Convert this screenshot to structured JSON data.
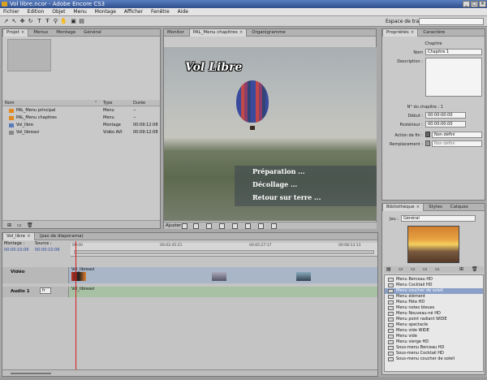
{
  "window": {
    "title": "Vol libre.ncor - Adobe Encore CS3"
  },
  "menubar": [
    "Fichier",
    "Edition",
    "Objet",
    "Menu",
    "Montage",
    "Afficher",
    "Fenêtre",
    "Aide"
  ],
  "toolbar": {
    "workspace_label": "Espace de travail :",
    "workspace_value": ""
  },
  "project": {
    "tabs": [
      "Projet",
      "Menus",
      "Montage",
      "Général"
    ],
    "columns": {
      "name": "Nom",
      "type": "Type",
      "duration": "Durée"
    },
    "rows": [
      {
        "name": "PAL_Menu principal",
        "type": "Menu",
        "duration": "--",
        "icon": "menu-icon",
        "color": "#e08a20"
      },
      {
        "name": "PAL_Menu chapitres",
        "type": "Menu",
        "duration": "--",
        "icon": "menu-icon",
        "color": "#e08a20"
      },
      {
        "name": "Vol_libre",
        "type": "Montage",
        "duration": "00:09:12:08",
        "icon": "timeline-icon",
        "color": "#5a7ab8"
      },
      {
        "name": "Vol_libreavi",
        "type": "Vidéo AVI",
        "duration": "00:09:12:08",
        "icon": "film-icon",
        "color": "#888888"
      }
    ]
  },
  "monitor": {
    "tabs": [
      "Monitor",
      "PAL_Menu chapitres",
      "Organigramme"
    ],
    "active_tab": "PAL_Menu chapitres",
    "menu_title": "Vol Libre",
    "menu_items": [
      "Préparation ...",
      "Décollage ...",
      "Retour sur terre ..."
    ],
    "fit_label": "Ajuster"
  },
  "properties": {
    "tabs": [
      "Propriétés",
      "Caractère"
    ],
    "header": "Chapitre",
    "name_label": "Nom",
    "name_value": "Chapitre 1",
    "description_label": "Description :",
    "chapter_no_label": "N° du chapitre : 1",
    "start_label": "Début :",
    "start_value": "00:00:00:00",
    "poster_label": "Postérieur :",
    "poster_value": "00:00:00:00",
    "end_action_label": "Action de fin :",
    "end_action_value": "Non défini",
    "override_label": "Remplacement :",
    "override_value": "Non défini"
  },
  "library": {
    "tabs": [
      "Bibliothèque",
      "Styles",
      "Calques"
    ],
    "set_label": "Jeu :",
    "set_value": "Général",
    "items": [
      "Menu Berceau HD",
      "Menu Cocktail HD",
      "Menu coucher de soleil",
      "Menu élément",
      "Menu Fête HD",
      "Menu notes bleues",
      "Menu Nouveau-né HD",
      "Menu point radiant WIDE",
      "Menu spectacle",
      "Menu vide WIDE",
      "Menu vide",
      "Menu vierge HD",
      "Sous-menu Berceau HD",
      "Sous-menu Cocktail HD",
      "Sous-menu coucher de soleil"
    ],
    "selected_index": 2
  },
  "timeline": {
    "tabs": [
      "Vol_libre",
      "(pas de diaporama)"
    ],
    "montage_label": "Montage :",
    "source_label": "Source :",
    "montage_tc": "00:00:10:06",
    "source_tc": "00:00:10:06",
    "ruler": [
      "00:00",
      "00:02:45:21",
      "00:05:27:17",
      "00:08:13:13"
    ],
    "video_track": "Vidéo",
    "audio_track": "Audio 1",
    "audio_lang": "fr",
    "video_clip": "Vol_libreavi",
    "audio_clip": "Vol_libreavi"
  }
}
